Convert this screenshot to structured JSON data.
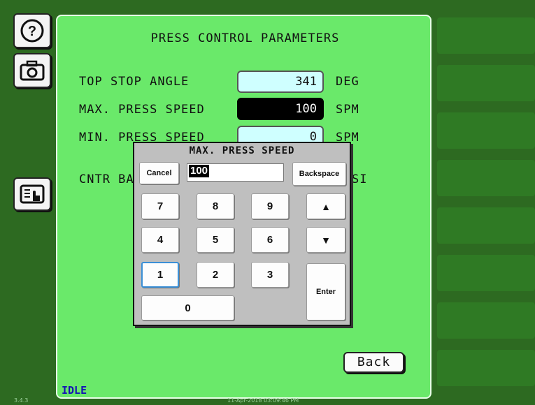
{
  "side": {
    "help_icon": "help-circle-icon",
    "camera_icon": "camera-icon",
    "touch_icon": "touch-panel-icon"
  },
  "panel": {
    "title": "PRESS CONTROL PARAMETERS",
    "params": [
      {
        "label": "TOP STOP ANGLE",
        "value": "341",
        "unit": "DEG"
      },
      {
        "label": "MAX. PRESS SPEED",
        "value": "100",
        "unit": "SPM"
      },
      {
        "label": "MIN. PRESS SPEED",
        "value": "0",
        "unit": "SPM"
      },
      {
        "label": "CNTR BA",
        "unit": "SI"
      }
    ],
    "back_label": "Back",
    "status": "IDLE"
  },
  "footer": {
    "version": "3.4.3",
    "datetime": "11-Apr-2018 03:09:46 PM"
  },
  "keypad": {
    "title": "MAX. PRESS SPEED",
    "cancel_label": "Cancel",
    "entry_value": "100",
    "backspace_label": "Backspace",
    "keys": [
      "7",
      "8",
      "9",
      "4",
      "5",
      "6",
      "1",
      "2",
      "3",
      "0"
    ],
    "up_label": "▲",
    "down_label": "▼",
    "enter_label": "Enter"
  },
  "colors": {
    "background": "#2d6a21",
    "panel": "#6ae96a",
    "status_text": "#1414b4"
  }
}
